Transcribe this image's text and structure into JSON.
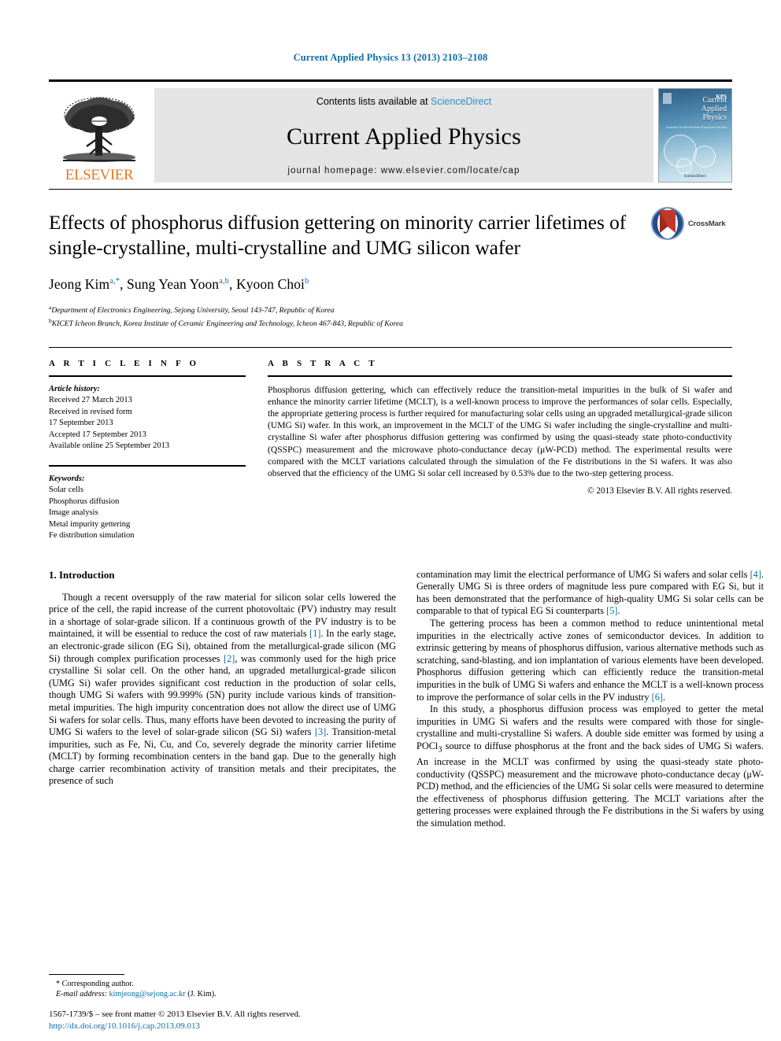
{
  "running_head": "Current Applied Physics 13 (2013) 2103–2108",
  "masthead": {
    "publisher_name": "ELSEVIER",
    "contents_prefix": "Contents lists available at ",
    "contents_link": "ScienceDirect",
    "journal_name": "Current Applied Physics",
    "homepage": "journal homepage: www.elsevier.com/locate/cap",
    "cover": {
      "line1": "Current",
      "line2": "Applied",
      "line3": "Physics",
      "society": "KPS",
      "subtitle": "Journal of the Korean Physical Society",
      "footer": "ScienceDirect"
    }
  },
  "article": {
    "title": "Effects of phosphorus diffusion gettering on minority carrier lifetimes of single-crystalline, multi-crystalline and UMG silicon wafer",
    "crossmark_label": "CrossMark",
    "authors": [
      {
        "name": "Jeong Kim",
        "marks": "a,*"
      },
      {
        "name": "Sung Yean Yoon",
        "marks": "a,b"
      },
      {
        "name": "Kyoon Choi",
        "marks": "b"
      }
    ],
    "affiliations": [
      {
        "mark": "a",
        "text": "Department of Electronics Engineering, Sejong University, Seoul 143-747, Republic of Korea"
      },
      {
        "mark": "b",
        "text": "KICET Icheon Branch, Korea Institute of Ceramic Engineering and Technology, Icheon 467-843, Republic of Korea"
      }
    ]
  },
  "article_info": {
    "heading": "A R T I C L E  I N F O",
    "history_label": "Article history:",
    "history": [
      "Received 27 March 2013",
      "Received in revised form",
      "17 September 2013",
      "Accepted 17 September 2013",
      "Available online 25 September 2013"
    ],
    "keywords_label": "Keywords:",
    "keywords": [
      "Solar cells",
      "Phosphorus diffusion",
      "Image analysis",
      "Metal impurity gettering",
      "Fe distribution simulation"
    ]
  },
  "abstract": {
    "heading": "A B S T R A C T",
    "text": "Phosphorus diffusion gettering, which can effectively reduce the transition-metal impurities in the bulk of Si wafer and enhance the minority carrier lifetime (MCLT), is a well-known process to improve the performances of solar cells. Especially, the appropriate gettering process is further required for manufacturing solar cells using an upgraded metallurgical-grade silicon (UMG Si) wafer. In this work, an improvement in the MCLT of the UMG Si wafer including the single-crystalline and multi-crystalline Si wafer after phosphorus diffusion gettering was confirmed by using the quasi-steady state photo-conductivity (QSSPC) measurement and the microwave photo-conductance decay (μW-PCD) method. The experimental results were compared with the MCLT variations calculated through the simulation of the Fe distributions in the Si wafers. It was also observed that the efficiency of the UMG Si solar cell increased by 0.53% due to the two-step gettering process.",
    "copyright": "© 2013 Elsevier B.V. All rights reserved."
  },
  "body": {
    "section_number_title": "1. Introduction",
    "left_paragraphs": [
      "Though a recent oversupply of the raw material for silicon solar cells lowered the price of the cell, the rapid increase of the current photovoltaic (PV) industry may result in a shortage of solar-grade silicon. If a continuous growth of the PV industry is to be maintained, it will be essential to reduce the cost of raw materials [1]. In the early stage, an electronic-grade silicon (EG Si), obtained from the metallurgical-grade silicon (MG Si) through complex purification processes [2], was commonly used for the high price crystalline Si solar cell. On the other hand, an upgraded metallurgical-grade silicon (UMG Si) wafer provides significant cost reduction in the production of solar cells, though UMG Si wafers with 99.999% (5N) purity include various kinds of transition-metal impurities. The high impurity concentration does not allow the direct use of UMG Si wafers for solar cells. Thus, many efforts have been devoted to increasing the purity of UMG Si wafers to the level of solar-grade silicon (SG Si) wafers [3]. Transition-metal impurities, such as Fe, Ni, Cu, and Co, severely degrade the minority carrier lifetime (MCLT) by forming recombination centers in the band gap. Due to the generally high charge carrier recombination activity of transition metals and their precipitates, the presence of such"
    ],
    "right_paragraphs": [
      "contamination may limit the electrical performance of UMG Si wafers and solar cells [4]. Generally UMG Si is three orders of magnitude less pure compared with EG Si, but it has been demonstrated that the performance of high-quality UMG Si solar cells can be comparable to that of typical EG Si counterparts [5].",
      "The gettering process has been a common method to reduce unintentional metal impurities in the electrically active zones of semiconductor devices. In addition to extrinsic gettering by means of phosphorus diffusion, various alternative methods such as scratching, sand-blasting, and ion implantation of various elements have been developed. Phosphorus diffusion gettering which can efficiently reduce the transition-metal impurities in the bulk of UMG Si wafers and enhance the MCLT is a well-known process to improve the performance of solar cells in the PV industry [6].",
      "In this study, a phosphorus diffusion process was employed to getter the metal impurities in UMG Si wafers and the results were compared with those for single-crystalline and multi-crystalline Si wafers. A double side emitter was formed by using a POCl3 source to diffuse phosphorus at the front and the back sides of UMG Si wafers. An increase in the MCLT was confirmed by using the quasi-steady state photo-conductivity (QSSPC) measurement and the microwave photo-conductance decay (μW-PCD) method, and the efficiencies of the UMG Si solar cells were measured to determine the effectiveness of phosphorus diffusion gettering. The MCLT variations after the gettering processes were explained through the Fe distributions in the Si wafers by using the simulation method."
    ]
  },
  "footer": {
    "corresponding_mark": "*",
    "corresponding_label": "Corresponding author.",
    "email_label": "E-mail address:",
    "email": "kimjeong@sejong.ac.kr",
    "email_owner": "(J. Kim).",
    "issn_line": "1567-1739/$ – see front matter © 2013 Elsevier B.V. All rights reserved.",
    "doi": "http://dx.doi.org/10.1016/j.cap.2013.09.013"
  },
  "colors": {
    "link": "#0a6ea8",
    "elsevier_orange": "#e87722",
    "masthead_gray": "#e4e4e4"
  }
}
